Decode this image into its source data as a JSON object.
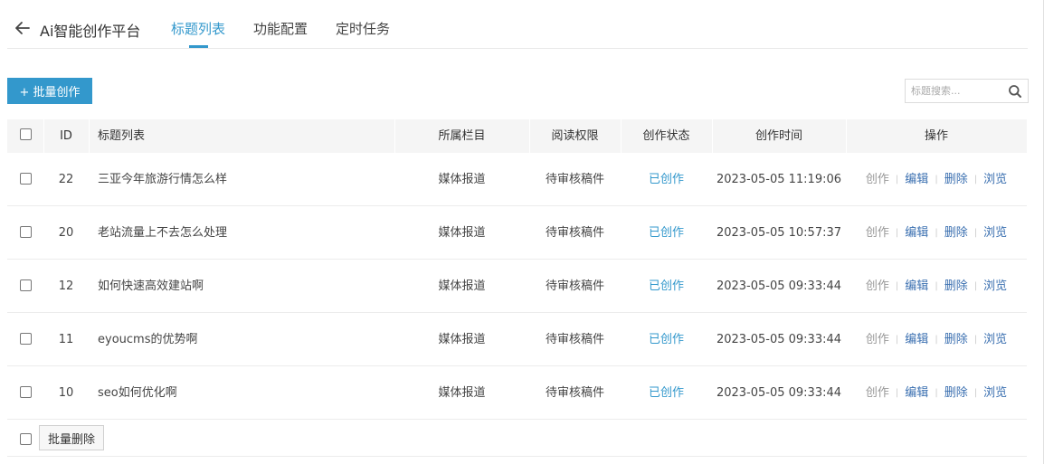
{
  "header": {
    "title": "Ai智能创作平台",
    "tabs": [
      {
        "label": "标题列表",
        "active": true
      },
      {
        "label": "功能配置",
        "active": false
      },
      {
        "label": "定时任务",
        "active": false
      }
    ]
  },
  "toolbar": {
    "batch_create_label": "+ 批量创作",
    "search_placeholder": "标题搜索..."
  },
  "table": {
    "columns": [
      "ID",
      "标题列表",
      "所属栏目",
      "阅读权限",
      "创作状态",
      "创作时间",
      "操作"
    ],
    "rows": [
      {
        "id": "22",
        "title": "三亚今年旅游行情怎么样",
        "column": "媒体报道",
        "permission": "待审核稿件",
        "status": "已创作",
        "time": "2023-05-05 11:19:06"
      },
      {
        "id": "20",
        "title": "老站流量上不去怎么处理",
        "column": "媒体报道",
        "permission": "待审核稿件",
        "status": "已创作",
        "time": "2023-05-05 10:57:37"
      },
      {
        "id": "12",
        "title": "如何快速高效建站啊",
        "column": "媒体报道",
        "permission": "待审核稿件",
        "status": "已创作",
        "time": "2023-05-05 09:33:44"
      },
      {
        "id": "11",
        "title": "eyoucms的优势啊",
        "column": "媒体报道",
        "permission": "待审核稿件",
        "status": "已创作",
        "time": "2023-05-05 09:33:44"
      },
      {
        "id": "10",
        "title": "seo如何优化啊",
        "column": "媒体报道",
        "permission": "待审核稿件",
        "status": "已创作",
        "time": "2023-05-05 09:33:44"
      }
    ],
    "actions": {
      "create": "创作",
      "edit": "编辑",
      "delete": "删除",
      "browse": "浏览",
      "separator": "|"
    }
  },
  "footer": {
    "batch_delete_label": "批量删除"
  },
  "colors": {
    "accent": "#3398cc",
    "link": "#3a6fb0",
    "header_bg": "#f5f5f5"
  },
  "icons": {
    "back": "arrow-left-icon",
    "search": "magnifier-icon"
  }
}
